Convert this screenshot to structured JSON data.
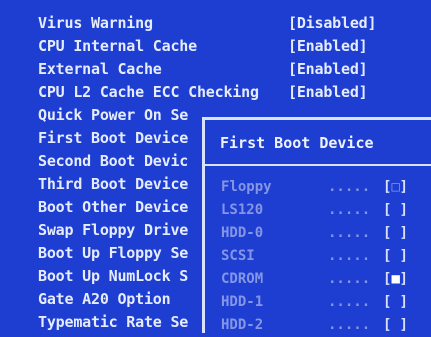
{
  "settings": [
    {
      "label": "Virus Warning",
      "value": "[Disabled]"
    },
    {
      "label": "CPU Internal Cache",
      "value": "[Enabled]"
    },
    {
      "label": "External Cache",
      "value": "[Enabled]"
    },
    {
      "label": "CPU L2 Cache ECC Checking",
      "value": "[Enabled]"
    },
    {
      "label": "Quick Power On Se",
      "value": ""
    },
    {
      "label": "First Boot Device",
      "value": ""
    },
    {
      "label": "Second Boot Devic",
      "value": ""
    },
    {
      "label": "Third Boot Device",
      "value": ""
    },
    {
      "label": "Boot Other Device",
      "value": ""
    },
    {
      "label": "Swap Floppy Drive",
      "value": ""
    },
    {
      "label": "Boot Up Floppy Se",
      "value": ""
    },
    {
      "label": "Boot Up NumLock S",
      "value": ""
    },
    {
      "label": "Gate A20 Option",
      "value": ""
    },
    {
      "label": "Typematic Rate Se",
      "value": ""
    }
  ],
  "popup": {
    "title": "First Boot Device",
    "options": [
      {
        "name": "Floppy",
        "dots": ".....",
        "open": "[",
        "mark": "□",
        "close": "]",
        "selected": false
      },
      {
        "name": "LS120",
        "dots": ".....",
        "open": "[",
        "mark": " ",
        "close": "]",
        "selected": false
      },
      {
        "name": "HDD-0",
        "dots": ".....",
        "open": "[",
        "mark": " ",
        "close": "]",
        "selected": false
      },
      {
        "name": "SCSI",
        "dots": ".....",
        "open": "[",
        "mark": " ",
        "close": "]",
        "selected": false
      },
      {
        "name": "CDROM",
        "dots": ".....",
        "open": "[",
        "mark": "■",
        "close": "]",
        "selected": true
      },
      {
        "name": "HDD-1",
        "dots": ".....",
        "open": "[",
        "mark": " ",
        "close": "]",
        "selected": false
      },
      {
        "name": "HDD-2",
        "dots": ".....",
        "open": "[",
        "mark": " ",
        "close": "]",
        "selected": false
      }
    ]
  }
}
